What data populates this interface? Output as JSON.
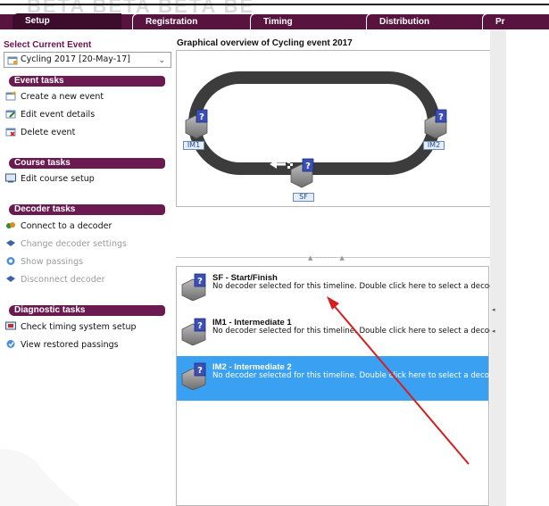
{
  "watermark": "BETA BETA BETA BE",
  "tabs": [
    {
      "label": "Setup",
      "active": true
    },
    {
      "label": "Registration",
      "active": false
    },
    {
      "label": "Timing",
      "active": false
    },
    {
      "label": "Distribution",
      "active": false
    },
    {
      "label": "Pr",
      "active": false
    }
  ],
  "left_panel": {
    "select_label": "Select Current Event",
    "current_event": "Cycling 2017 [20-May-17]",
    "sections": [
      {
        "title": "Event tasks",
        "items": [
          {
            "label": "Create a new event",
            "icon": "new-event-icon",
            "enabled": true
          },
          {
            "label": "Edit event details",
            "icon": "edit-event-icon",
            "enabled": true
          },
          {
            "label": "Delete event",
            "icon": "delete-event-icon",
            "enabled": true
          }
        ]
      },
      {
        "title": "Course tasks",
        "items": [
          {
            "label": "Edit course setup",
            "icon": "course-setup-icon",
            "enabled": true
          }
        ]
      },
      {
        "title": "Decoder tasks",
        "items": [
          {
            "label": "Connect to a decoder",
            "icon": "connect-icon",
            "enabled": true
          },
          {
            "label": "Change decoder settings",
            "icon": "decoder-settings-icon",
            "enabled": false
          },
          {
            "label": "Show passings",
            "icon": "show-passings-icon",
            "enabled": false
          },
          {
            "label": "Disconnect decoder",
            "icon": "disconnect-icon",
            "enabled": false
          }
        ]
      },
      {
        "title": "Diagnostic tasks",
        "items": [
          {
            "label": "Check timing system setup",
            "icon": "check-timing-icon",
            "enabled": true
          },
          {
            "label": "View restored passings",
            "icon": "restored-passings-icon",
            "enabled": true
          }
        ]
      }
    ]
  },
  "overview": {
    "title": "Graphical overview of Cycling event 2017",
    "markers": {
      "im1": "IM1",
      "im2": "IM2",
      "sf": "SF"
    }
  },
  "decoders": [
    {
      "title": "SF - Start/Finish",
      "desc": "No decoder selected for this timeline. Double click here to select a decoder",
      "selected": false
    },
    {
      "title": "IM1 - Intermediate 1",
      "desc": "No decoder selected for this timeline. Double click here to select a decoder",
      "selected": false
    },
    {
      "title": "IM2 - Intermediate 2",
      "desc": "No decoder selected for this timeline. Double click here to select a decoder",
      "selected": true
    }
  ],
  "colors": {
    "brand": "#58143f",
    "section_head": "#6a1a50",
    "selection": "#3aa0f2",
    "annotation": "#d42020"
  }
}
